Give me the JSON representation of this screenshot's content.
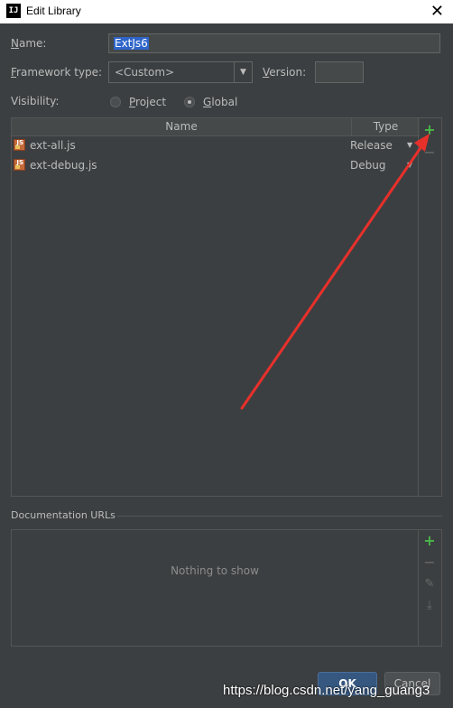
{
  "window": {
    "title": "Edit Library",
    "app_icon": "IJ",
    "close": "✕"
  },
  "form": {
    "name_label_mnemonic": "N",
    "name_label_rest": "ame:",
    "name_value": "ExtJs6",
    "framework_label_mnemonic": "F",
    "framework_label_rest": "ramework type:",
    "framework_value": "<Custom>",
    "version_label_mnemonic": "V",
    "version_label_rest": "ersion:",
    "version_value": "",
    "visibility_label": "Visibility:",
    "visibility_options": [
      {
        "label_mnemonic": "P",
        "label_rest": "roject",
        "checked": false
      },
      {
        "label_mnemonic": "G",
        "label_rest": "lobal",
        "checked": true
      }
    ]
  },
  "files_table": {
    "columns": [
      "Name",
      "Type"
    ],
    "rows": [
      {
        "icon": "js-file-icon",
        "name": "ext-all.js",
        "type": "Release"
      },
      {
        "icon": "js-file-icon",
        "name": "ext-debug.js",
        "type": "Debug"
      }
    ],
    "add_icon": "+",
    "remove_icon": "−"
  },
  "docs": {
    "label": "Documentation URLs",
    "empty_text": "Nothing to show",
    "add_icon": "+",
    "remove_icon": "−",
    "edit_icon": "✎",
    "download_icon": "⤓"
  },
  "buttons": {
    "ok": "OK",
    "cancel": "Cancel"
  },
  "watermark": "https://blog.csdn.net/yang_guang3",
  "colors": {
    "background": "#3c3f41",
    "accent_green": "#49b749",
    "selection": "#2f65ca",
    "annotation_arrow": "#e8302b"
  }
}
